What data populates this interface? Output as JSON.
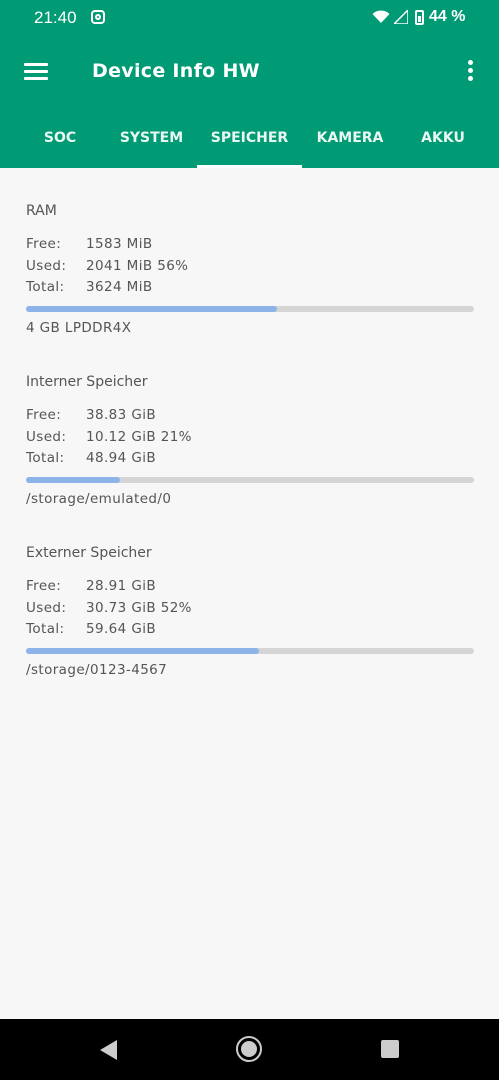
{
  "status_bar": {
    "time": "21:40",
    "battery_percent": "44 %"
  },
  "app_bar": {
    "title": "Device Info HW"
  },
  "tabs": [
    {
      "label": "SOC",
      "active": false
    },
    {
      "label": "SYSTEM",
      "active": false
    },
    {
      "label": "SPEICHER",
      "active": true
    },
    {
      "label": "KAMERA",
      "active": false
    },
    {
      "label": "AKKU",
      "active": false
    }
  ],
  "sections": [
    {
      "title": "RAM",
      "rows": [
        {
          "key": "Free:",
          "value": "1583 MiB"
        },
        {
          "key": "Used:",
          "value": "2041 MiB 56%"
        },
        {
          "key": "Total:",
          "value": "3624 MiB"
        }
      ],
      "usage_fraction": 0.56,
      "footer": "4 GB LPDDR4X"
    },
    {
      "title": "Interner Speicher",
      "rows": [
        {
          "key": "Free:",
          "value": "38.83 GiB"
        },
        {
          "key": "Used:",
          "value": "10.12 GiB 21%"
        },
        {
          "key": "Total:",
          "value": "48.94 GiB"
        }
      ],
      "usage_fraction": 0.21,
      "footer": "/storage/emulated/0"
    },
    {
      "title": "Externer Speicher",
      "rows": [
        {
          "key": "Free:",
          "value": "28.91 GiB"
        },
        {
          "key": "Used:",
          "value": "30.73 GiB 52%"
        },
        {
          "key": "Total:",
          "value": "59.64 GiB"
        }
      ],
      "usage_fraction": 0.52,
      "footer": "/storage/0123-4567"
    }
  ],
  "colors": {
    "primary": "#009a74",
    "bar_fill": "#8db3e9",
    "bar_track": "#d5d5d5"
  }
}
